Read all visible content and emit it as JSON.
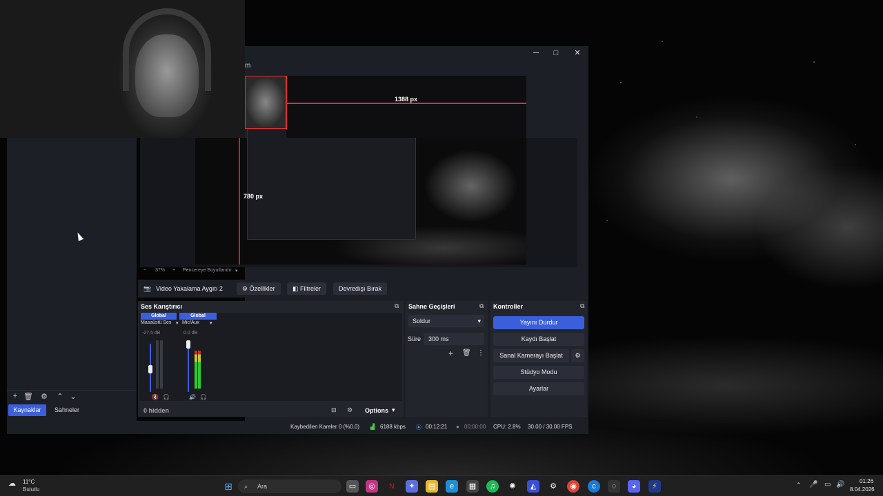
{
  "window": {
    "menu_partial": "m",
    "minimize": "─",
    "maximize": "□",
    "close": "✕"
  },
  "preview": {
    "width_label": "1388 px",
    "height_label": "780 px",
    "zoom": "37%",
    "fit_mode": "Pencereye Boyutlandır"
  },
  "source_toolbar": {
    "source_name": "Video Yakalama Aygıtı 2",
    "properties": "Özellikler",
    "filters": "Filtreler",
    "deactivate": "Devredışı Bırak"
  },
  "sources_dock": {
    "tabs": [
      "Kaynaklar",
      "Sahneler"
    ]
  },
  "audio_mixer": {
    "title": "Ses Karıştırıcı",
    "channels": [
      {
        "scope": "Global",
        "name": "Masaüstü Ses",
        "db": "-27.5 dB",
        "level": 0.0,
        "volume": 0.35
      },
      {
        "scope": "Global",
        "name": "Mic/Aux",
        "db": "0.0 dB",
        "level": 0.7,
        "volume": 0.9
      }
    ],
    "hidden": "0 hidden",
    "options": "Options"
  },
  "transitions": {
    "title": "Sahne Geçişleri",
    "selected": "Soldur",
    "duration_label": "Süre",
    "duration_value": "300 ms"
  },
  "controls": {
    "title": "Kontroller",
    "buttons": [
      "Yayını Durdur",
      "Kaydı Başlat",
      "Sanal Kamerayı Başlat",
      "Stüdyo Modu",
      "Ayarlar"
    ]
  },
  "status": {
    "dropped": "Kaybedilen Kareler 0 (%0.0)",
    "bitrate": "6188 kbps",
    "stream_time": "00:12:21",
    "record_time": "00:00:00",
    "cpu": "CPU: 2.8%",
    "fps": "30.00 / 30.00 FPS"
  },
  "taskbar": {
    "weather_temp": "11°C",
    "weather_desc": "Bulutlu",
    "search": "Ara",
    "time": "01:26",
    "date": "8.04.2026"
  },
  "colors": {
    "accent": "#3b5fdc",
    "panel": "#23252d",
    "window": "#1d1f26",
    "guide_red": "#e03030"
  }
}
